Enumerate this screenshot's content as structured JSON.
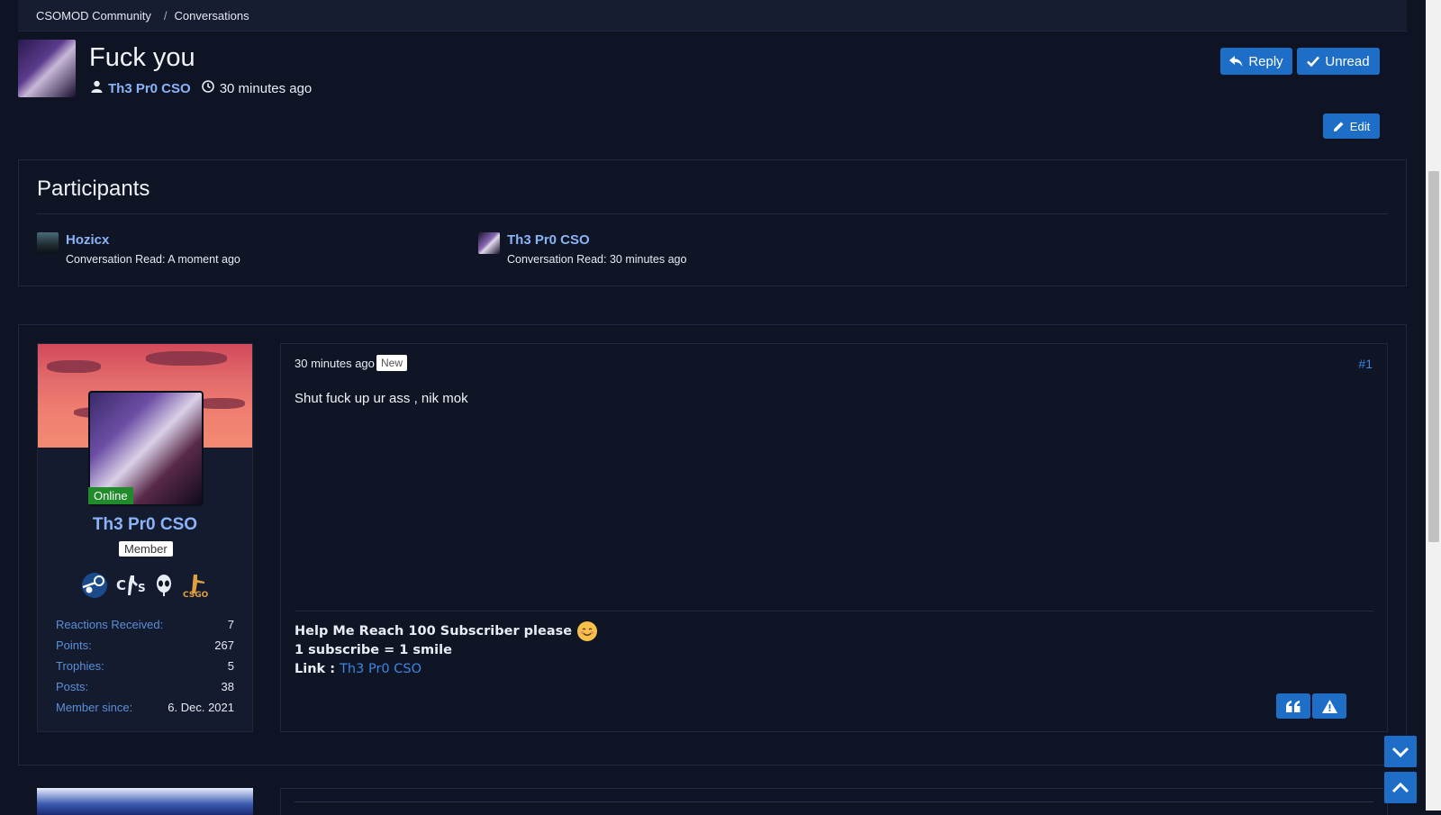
{
  "breadcrumb": {
    "items": [
      "CSOMOD Community",
      "Conversations"
    ]
  },
  "conversation": {
    "title": "Fuck you",
    "author": "Th3 Pr0 CSO",
    "time": "30 minutes ago"
  },
  "buttons": {
    "reply": "Reply",
    "unread": "Unread",
    "edit": "Edit"
  },
  "participants": {
    "title": "Participants",
    "list": [
      {
        "name": "Hozicx",
        "read": "Conversation Read: A moment ago"
      },
      {
        "name": "Th3 Pr0 CSO",
        "read": "Conversation Read: 30 minutes ago"
      }
    ]
  },
  "user_card": {
    "status": "Online",
    "name": "Th3 Pr0 CSO",
    "role": "Member",
    "badges": [
      "steam-icon",
      "cs-icon",
      "alien-icon",
      "csgo-icon"
    ],
    "stats": [
      {
        "label": "Reactions Received:",
        "value": "7"
      },
      {
        "label": "Points:",
        "value": "267"
      },
      {
        "label": "Trophies:",
        "value": "5"
      },
      {
        "label": "Posts:",
        "value": "38"
      },
      {
        "label": "Member since:",
        "value": "6. Dec. 2021"
      }
    ]
  },
  "post": {
    "time": "30 minutes ago",
    "badge": "New",
    "number": "#1",
    "body": "Shut fuck up ur ass , nik mok",
    "signature": {
      "line1": "Help Me Reach 100 Subscriber please",
      "line2": "1 subscribe = 1 smile",
      "line3_label": "Link : ",
      "line3_link": "Th3 Pr0 CSO"
    }
  },
  "colors": {
    "accent": "#1e6ec8",
    "link": "#8ab4f8",
    "background": "#0e1424",
    "online": "#1f8b2a"
  }
}
